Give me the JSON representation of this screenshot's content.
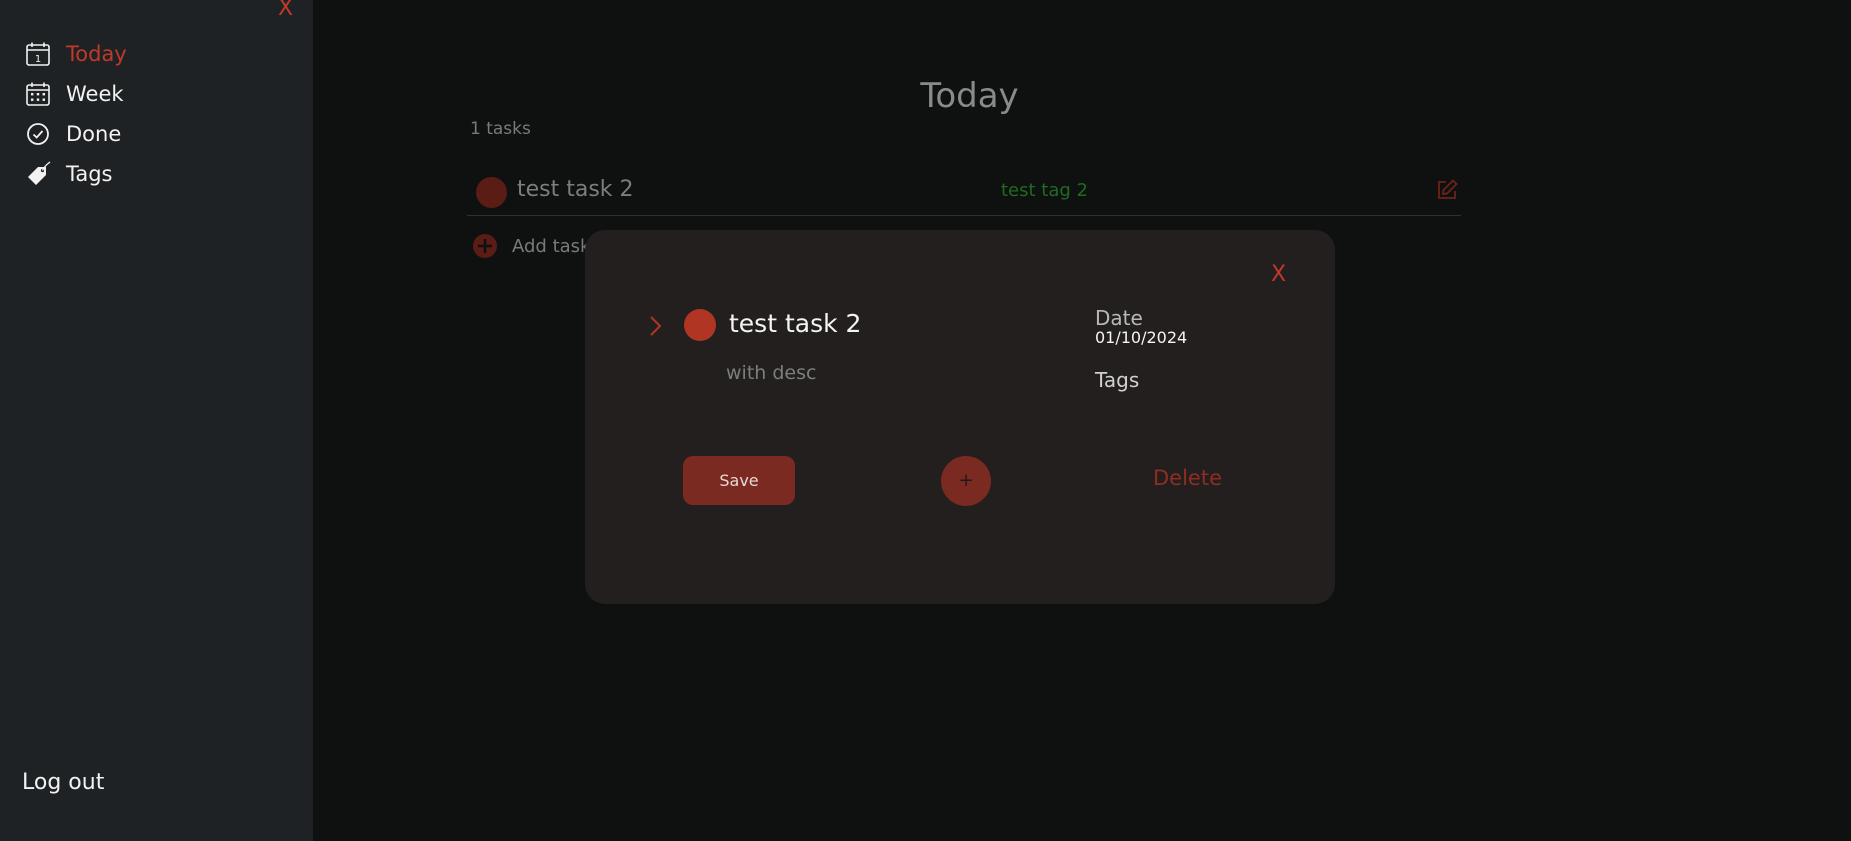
{
  "sidebar": {
    "close_label": "X",
    "items": [
      {
        "label": "Today",
        "icon": "calendar-day-icon",
        "active": true
      },
      {
        "label": "Week",
        "icon": "calendar-week-icon",
        "active": false
      },
      {
        "label": "Done",
        "icon": "check-circle-icon",
        "active": false
      },
      {
        "label": "Tags",
        "icon": "tag-icon",
        "active": false
      }
    ],
    "logout_label": "Log out"
  },
  "main": {
    "title": "Today",
    "task_count": "1 tasks",
    "tasks": [
      {
        "title": "test task 2",
        "tag": "test tag 2"
      }
    ],
    "add_task_label": "Add task"
  },
  "modal": {
    "close_label": "X",
    "task_title": "test task 2",
    "task_description": "with desc",
    "date_label": "Date",
    "date_value": "01/10/2024",
    "tags_label": "Tags",
    "save_label": "Save",
    "add_tag_label": "+",
    "delete_label": "Delete"
  },
  "colors": {
    "accent": "#c0392b",
    "sidebar_bg": "#1f2224",
    "main_bg": "#0f1111",
    "modal_bg": "#241f1f",
    "tag_green": "#1f6b1f"
  }
}
